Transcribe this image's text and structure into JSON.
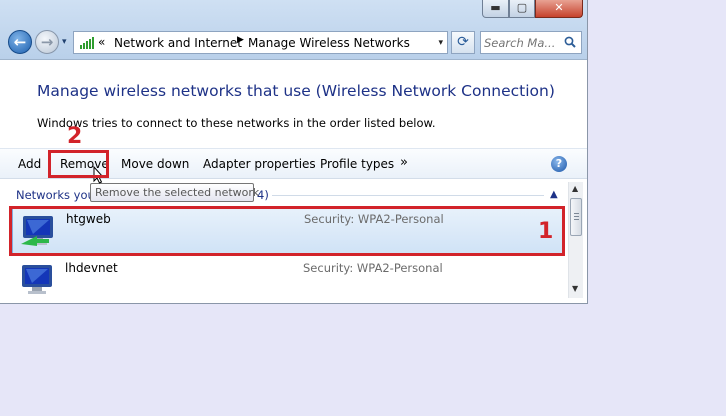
{
  "window": {
    "caption_buttons": {
      "minimize": "▬",
      "maximize": "▢",
      "close": "✕"
    }
  },
  "nav": {
    "back_icon": "arrow-left-icon",
    "forward_icon": "arrow-right-icon",
    "history_icon": "▾"
  },
  "address_bar": {
    "chevrons": "«",
    "crumbs": [
      "Network and Internet",
      "Manage Wireless Networks"
    ],
    "separator": "▶",
    "dropdown": "▾"
  },
  "refresh": "⟳",
  "search": {
    "placeholder": "Search Ma..."
  },
  "content": {
    "title": "Manage wireless networks that use (Wireless Network Connection)",
    "description": "Windows tries to connect to these networks in the order listed below."
  },
  "toolbar": {
    "add": "Add",
    "remove": "Remove",
    "move_down": "Move down",
    "adapter_properties": "Adapter properties",
    "profile_types": "Profile types",
    "more": "»",
    "help": "?"
  },
  "network_list": {
    "group_header": "Networks you",
    "group_count_suffix": "4)",
    "collapse": "▲",
    "networks": [
      {
        "name": "htgweb",
        "security": "Security:  WPA2-Personal",
        "selected": true
      },
      {
        "name": "lhdevnet",
        "security": "Security:  WPA2-Personal",
        "selected": false
      }
    ]
  },
  "scrollbar": {
    "up": "▲",
    "down": "▼"
  },
  "tooltip": "Remove the selected network",
  "annotations": {
    "box_1_label": "1",
    "box_2_label": "2",
    "color": "#d2232a"
  },
  "colors": {
    "title_blue": "#1e3287",
    "selection": "#cfe2f6",
    "close_red": "#c6422c"
  }
}
